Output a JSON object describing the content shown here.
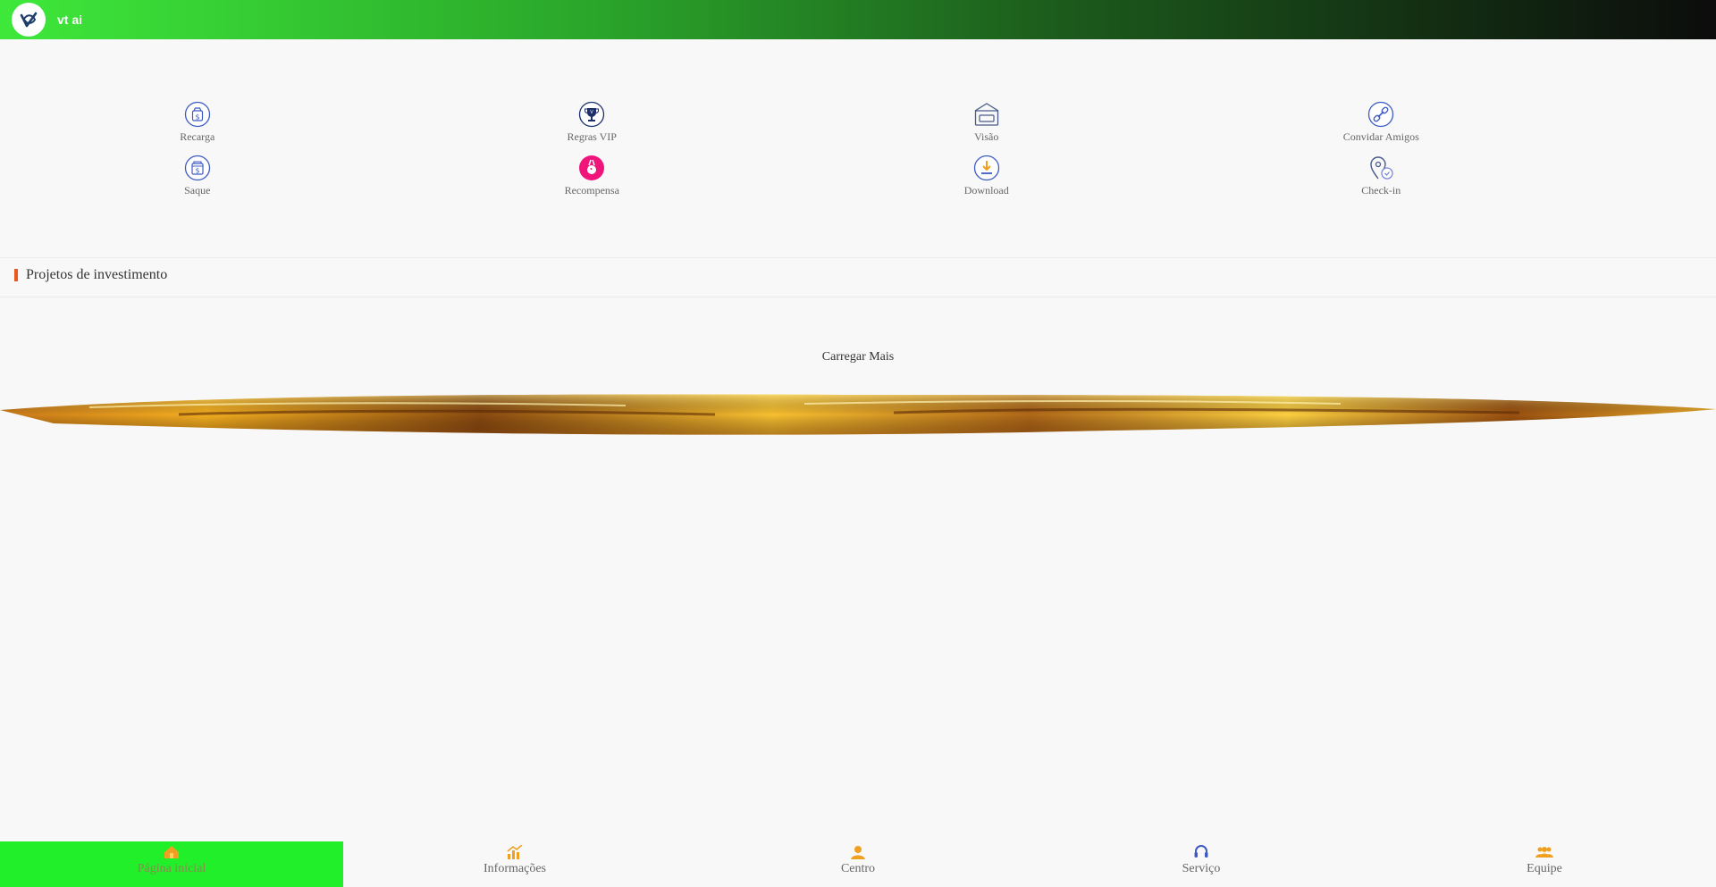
{
  "header": {
    "title": "vt ai"
  },
  "grid": {
    "items": [
      {
        "label": "Recarga",
        "icon": "recharge-icon"
      },
      {
        "label": "Regras VIP",
        "icon": "trophy-icon"
      },
      {
        "label": "Visão",
        "icon": "box-icon"
      },
      {
        "label": "Convidar Amigos",
        "icon": "link-icon"
      },
      {
        "label": "Saque",
        "icon": "withdraw-icon"
      },
      {
        "label": "Recompensa",
        "icon": "reward-icon"
      },
      {
        "label": "Download",
        "icon": "download-icon"
      },
      {
        "label": "Check-in",
        "icon": "checkin-icon"
      }
    ]
  },
  "section": {
    "title": "Projetos de investimento",
    "accent": "#e8581f"
  },
  "load_more": "Carregar Mais",
  "bottom_nav": {
    "items": [
      {
        "label": "Página inicial",
        "icon": "home-icon",
        "active": true
      },
      {
        "label": "Informações",
        "icon": "chart-icon",
        "active": false
      },
      {
        "label": "Centro",
        "icon": "user-icon",
        "active": false
      },
      {
        "label": "Serviço",
        "icon": "headset-icon",
        "active": false
      },
      {
        "label": "Equipe",
        "icon": "team-icon",
        "active": false
      }
    ]
  },
  "colors": {
    "active_nav": "#20ef2a",
    "icon_blue": "#3e5bc4",
    "reward_pink": "#f0157a",
    "orange": "#f0a020"
  }
}
